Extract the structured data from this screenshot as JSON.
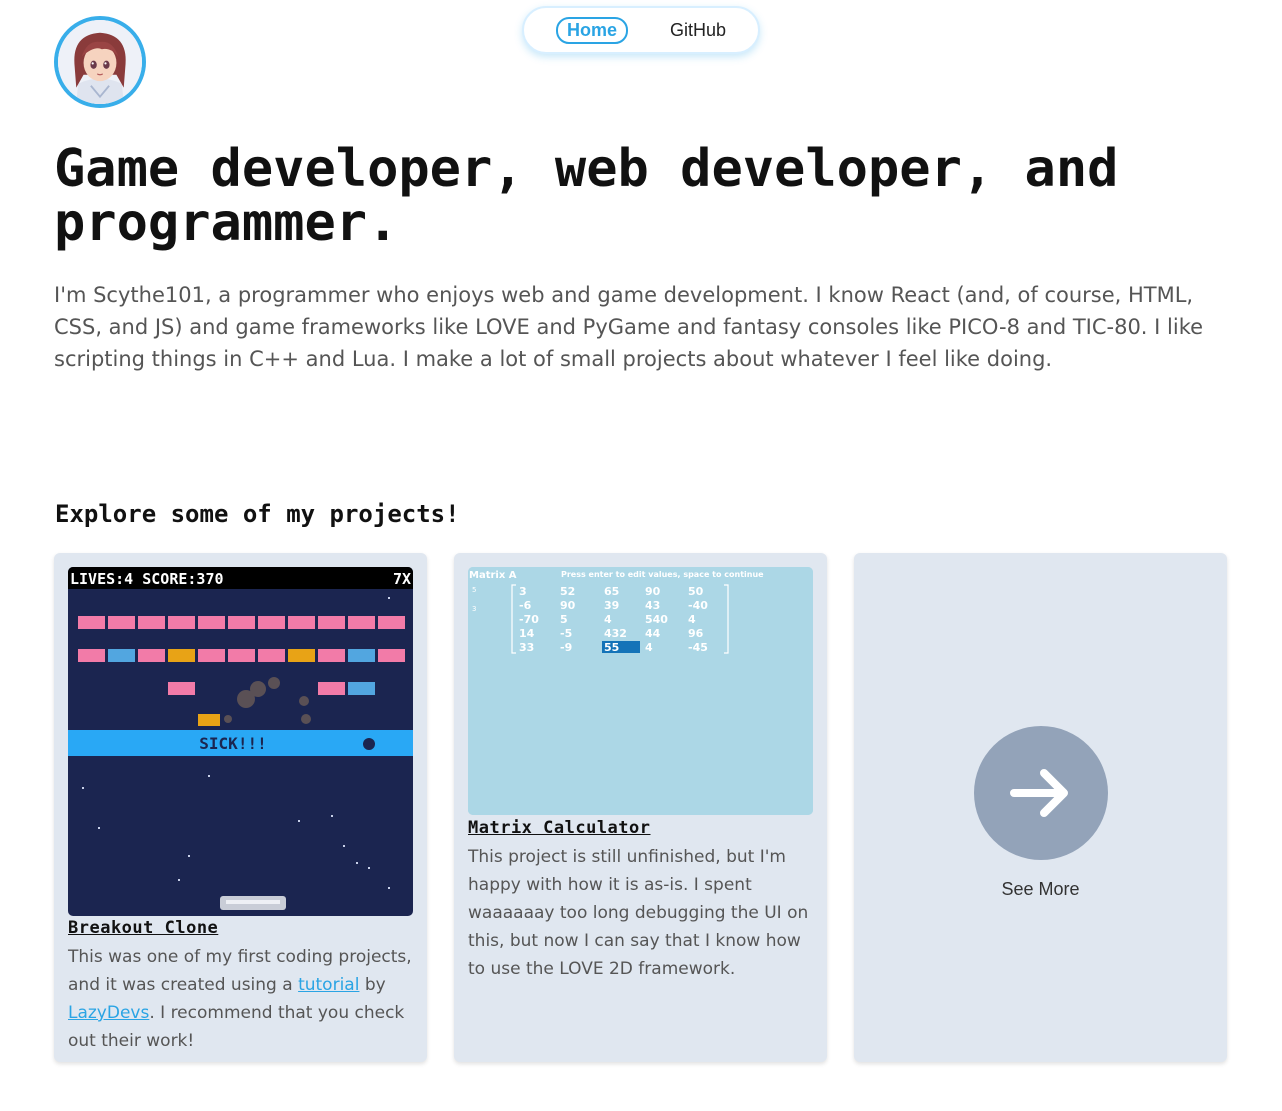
{
  "nav": {
    "home": "Home",
    "github": "GitHub"
  },
  "hero": {
    "title": "Game developer, web developer, and programmer.",
    "intro": "I'm Scythe101, a programmer who enjoys web and game development. I know React (and, of course, HTML, CSS, and JS) and game frameworks like LOVE and PyGame and fantasy consoles like PICO-8 and TIC-80. I like scripting things in C++ and Lua. I make a lot of small projects about whatever I feel like doing."
  },
  "projects": {
    "heading": "Explore some of my projects!",
    "breakout": {
      "title": "Breakout Clone",
      "text_before": "This was one of my first coding projects, and it was created using a ",
      "link_tutorial": "tutorial",
      "text_by": " by ",
      "link_author": "LazyDevs",
      "text_after": ". I recommend that you check out their work!",
      "game": {
        "hud": "LIVES:4   SCORE:370",
        "multiplier": "7X",
        "banner": "SICK!!!"
      }
    },
    "matrix": {
      "title": "Matrix Calculator",
      "text": "This project is still unfinished, but I'm happy with how it is as-is. I spent waaaaaay too long debugging the UI on this, but now I can say that I know how to use the LOVE 2D framework.",
      "screen": {
        "label": "Matrix A",
        "instructions": "Press enter to edit values, space to continue",
        "rows_label": "5",
        "cols_label": "3",
        "rows": [
          [
            "3",
            "52",
            "65",
            "90",
            "50"
          ],
          [
            "-6",
            "90",
            "39",
            "43",
            "-40"
          ],
          [
            "-70",
            "5",
            "4",
            "540",
            "4"
          ],
          [
            "14",
            "-5",
            "432",
            "44",
            "96"
          ],
          [
            "33",
            "-9",
            "55",
            "4",
            "-45"
          ]
        ],
        "selected": "55"
      }
    },
    "see_more": "See More"
  },
  "colors": {
    "accent": "#2aa4e4",
    "card_bg": "#e0e7f0",
    "see_more_circle": "#93a3b9",
    "game_bg": "#1b2550",
    "brick": "#f27ba8",
    "banner": "#29a8f5",
    "matrix_bg": "#acd7e6"
  },
  "icons": {
    "avatar": "anime-girl-avatar",
    "see_more": "arrow-right-icon"
  }
}
